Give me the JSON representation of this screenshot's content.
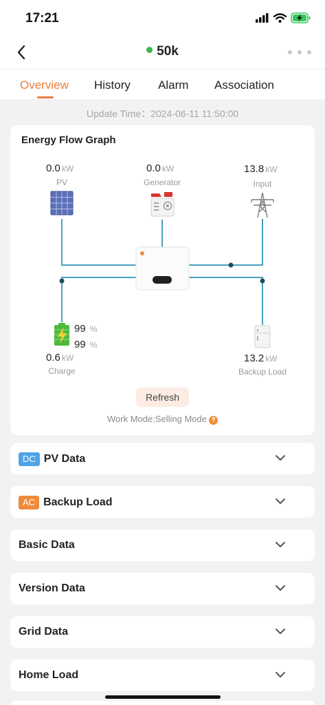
{
  "status_bar": {
    "time": "17:21"
  },
  "header": {
    "title": "50k"
  },
  "tabs": [
    {
      "label": "Overview"
    },
    {
      "label": "History"
    },
    {
      "label": "Alarm"
    },
    {
      "label": "Association"
    }
  ],
  "update_time": "Update Time：2024-06-11 11:50:00",
  "energy_flow": {
    "title": "Energy Flow Graph",
    "pv": {
      "value": "0.0",
      "unit": "kW",
      "label": "PV"
    },
    "generator": {
      "value": "0.0",
      "unit": "kW",
      "label": "Generator"
    },
    "input": {
      "value": "13.8",
      "unit": "kW",
      "label": "Input"
    },
    "battery": {
      "soc_1": "99",
      "soc_1_unit": "%",
      "soc_2": "99",
      "soc_2_unit": "%",
      "value": "0.6",
      "unit": "kW",
      "label": "Charge"
    },
    "backup_load": {
      "value": "13.2",
      "unit": "kW",
      "label": "Backup Load"
    },
    "refresh_label": "Refresh",
    "work_mode": "Work Mode:Selling Mode",
    "help_glyph": "?"
  },
  "sections": [
    {
      "badge": "DC",
      "badge_color": "#4fa3e6",
      "label": "PV Data"
    },
    {
      "badge": "AC",
      "badge_color": "#ee8a3c",
      "label": "Backup Load"
    },
    {
      "label": "Basic Data"
    },
    {
      "label": "Version Data"
    },
    {
      "label": "Grid Data"
    },
    {
      "label": "Home Load"
    }
  ],
  "colors": {
    "accent": "#ee7d3e",
    "flow_line": "#4a9fbf",
    "online": "#3cb54a"
  },
  "icons": [
    "back-arrow-icon",
    "more-icon",
    "solar-panel-icon",
    "generator-icon",
    "power-tower-icon",
    "inverter-icon",
    "battery-icon",
    "fridge-icon",
    "chevron-down-icon",
    "help-icon"
  ]
}
